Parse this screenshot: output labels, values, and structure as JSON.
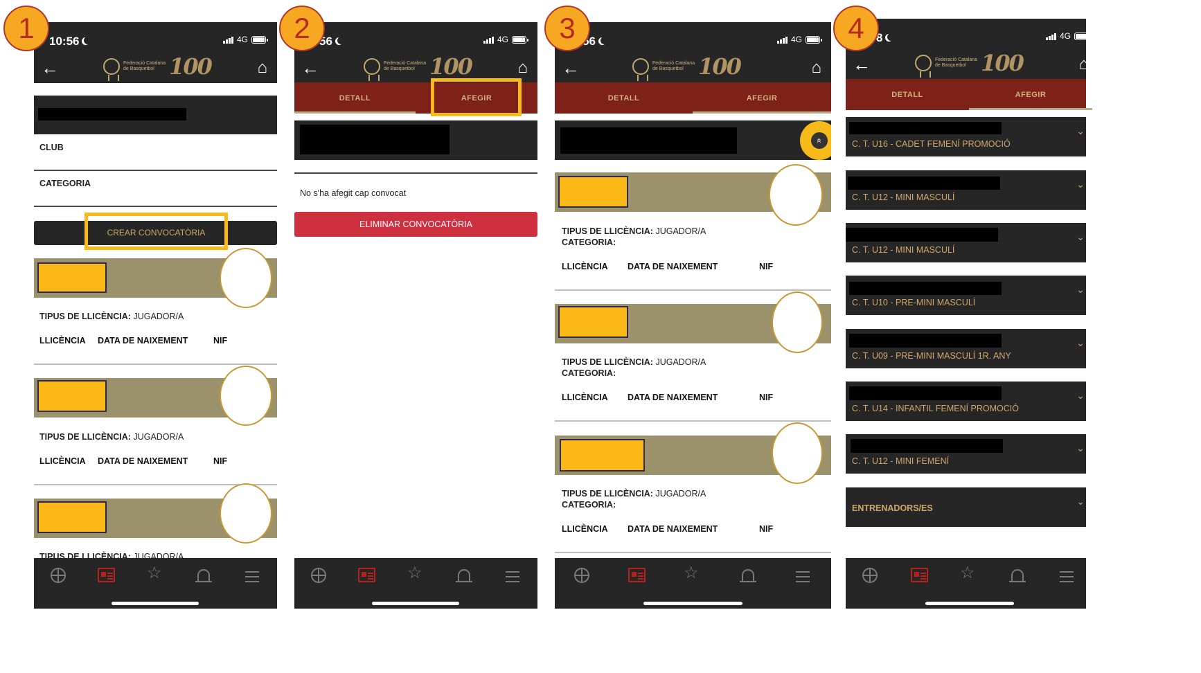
{
  "steps": [
    "1",
    "2",
    "3",
    "4"
  ],
  "status": {
    "time1": "10:56",
    "time2": "56",
    "time3": "56",
    "time4": "8",
    "network": "4G"
  },
  "header": {
    "back": "←",
    "home": "⌂",
    "logo_text_line1": "Federació Catalana",
    "logo_text_line2": "de Basquetbol",
    "logo_badge": "FCBQ",
    "logo_number": "100"
  },
  "tabs": {
    "detail": "DETALL",
    "add": "AFEGIR"
  },
  "screen1": {
    "fields": [
      "CLUB",
      "CATEGORIA"
    ],
    "create_button": "CREAR CONVOCATÒRIA",
    "players": [
      {
        "type_label": "TIPUS DE LLICÈNCIA:",
        "type_value": "JUGADOR/A"
      },
      {
        "type_label": "TIPUS DE LLICÈNCIA:",
        "type_value": "JUGADOR/A"
      },
      {
        "type_label": "TIPUS DE LLICÈNCIA:",
        "type_value": "JUGADOR/A"
      }
    ],
    "columns": [
      "LLICÈNCIA",
      "DATA DE NAIXEMENT",
      "NIF"
    ]
  },
  "screen2": {
    "empty_message": "No s'ha afegit cap convocat",
    "delete_button": "ELIMINAR CONVOCATÒRIA"
  },
  "screen3": {
    "players": [
      {
        "type_label": "TIPUS DE LLICÈNCIA:",
        "type_value": "JUGADOR/A",
        "category_label": "CATEGORIA:"
      },
      {
        "type_label": "TIPUS DE LLICÈNCIA:",
        "type_value": "JUGADOR/A",
        "category_label": "CATEGORIA:"
      },
      {
        "type_label": "TIPUS DE LLICÈNCIA:",
        "type_value": "JUGADOR/A",
        "category_label": "CATEGORIA:"
      }
    ],
    "columns": [
      "LLICÈNCIA",
      "DATA DE NAIXEMENT",
      "NIF"
    ],
    "collapse_icon": "«"
  },
  "screen4": {
    "teams": [
      "C. T. U16 - CADET FEMENÍ PROMOCIÓ",
      "C. T. U12 - MINI MASCULÍ",
      "C. T. U12 - MINI MASCULÍ",
      "C. T. U10 - PRE-MINI MASCULÍ",
      "C. T. U09 - PRE-MINI MASCULÍ 1R. ANY",
      "C. T. U14 - INFANTIL FEMENÍ PROMOCIÓ",
      "C. T. U12 - MINI FEMENÍ"
    ],
    "coaches": "ENTRENADORS/ES",
    "chevron": "⌄"
  },
  "nav": {
    "star": "☆"
  },
  "colors": {
    "highlight": "#f8b91a",
    "tab_bg": "#7d2119",
    "player_bar": "#9b916b",
    "danger": "#ce3040",
    "accent_gold": "#cfa76b"
  }
}
